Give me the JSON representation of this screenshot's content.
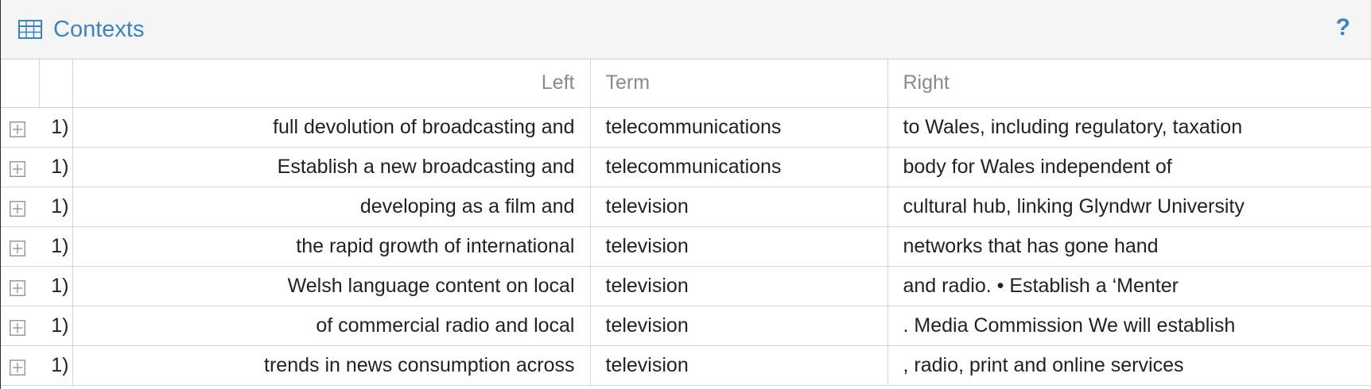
{
  "header": {
    "title": "Contexts",
    "help_label": "?"
  },
  "columns": {
    "left": "Left",
    "term": "Term",
    "right": "Right"
  },
  "rows": [
    {
      "num": "1)",
      "left": "full devolution of broadcasting and",
      "term": "telecommunications",
      "right": "to Wales, including regulatory, taxation"
    },
    {
      "num": "1)",
      "left": "Establish a new broadcasting and",
      "term": "telecommunications",
      "right": "body for Wales independent of"
    },
    {
      "num": "1)",
      "left": "developing as a film and",
      "term": "television",
      "right": "cultural hub, linking Glyndwr University"
    },
    {
      "num": "1)",
      "left": "the rapid growth of international",
      "term": "television",
      "right": "networks that has gone hand"
    },
    {
      "num": "1)",
      "left": "Welsh language content on local",
      "term": "television",
      "right": "and radio. • Establish a ‘Menter"
    },
    {
      "num": "1)",
      "left": "of commercial radio and local",
      "term": "television",
      "right": ". Media Commission We will establish"
    },
    {
      "num": "1)",
      "left": "trends in news consumption across",
      "term": "television",
      "right": ", radio, print and online services"
    }
  ],
  "colors": {
    "accent": "#3a84c3",
    "header_bg": "#f5f5f5",
    "border": "#d6d6d6"
  }
}
